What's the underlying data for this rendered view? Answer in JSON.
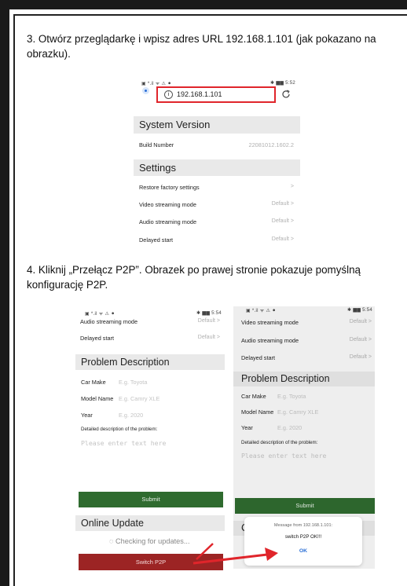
{
  "step3": {
    "text": "3. Otwórz przeglądarkę i wpisz adres URL 192.168.1.101 (jak pokazano na obrazku).",
    "status_left": "▣ *.il ᯤ ⚠ ⚫",
    "status_right": "✱ ▆▆ 5:52",
    "url": "192.168.1.101",
    "system_version": "System Version",
    "build_label": "Build Number",
    "build_value": "22081012.1602.2",
    "settings": "Settings",
    "rows": [
      {
        "label": "Restore factory settings",
        "value": ">"
      },
      {
        "label": "Video streaming mode",
        "value": "Default >"
      },
      {
        "label": "Audio streaming mode",
        "value": "Default >"
      },
      {
        "label": "Delayed start",
        "value": "Default >"
      }
    ]
  },
  "step4": {
    "text": "4. Kliknij „Przełącz P2P”. Obrazek po prawej stronie pokazuje pomyślną konfigurację P2P.",
    "left": {
      "status_left": "▣ *.il ᯤ ⚠ ⚫",
      "status_right": "✱ ▆▆ 5:54",
      "rows": [
        {
          "label": "Audio streaming mode",
          "value": "Default >"
        },
        {
          "label": "Delayed start",
          "value": "Default >"
        }
      ],
      "problem": "Problem Description",
      "fields": [
        {
          "label": "Car Make",
          "ph": "E.g. Toyota"
        },
        {
          "label": "Model Name",
          "ph": "E.g. Camry XLE"
        },
        {
          "label": "Year",
          "ph": "E.g. 2020"
        }
      ],
      "detail": "Detailed description of the problem:",
      "placeholder": "Please enter text here",
      "submit": "Submit",
      "online": "Online Update",
      "checking": "◌ Checking for updates...",
      "switch": "Switch P2P"
    },
    "right": {
      "status_left": "▣ *.il ᯤ ⚠ ⚫",
      "status_right": "✱ ▆▆ 5:54",
      "rows": [
        {
          "label": "Video streaming mode",
          "value": "Default >"
        },
        {
          "label": "Audio streaming mode",
          "value": "Default >"
        },
        {
          "label": "Delayed start",
          "value": "Default >"
        }
      ],
      "problem": "Problem Description",
      "fields": [
        {
          "label": "Car Make",
          "ph": "E.g. Toyota"
        },
        {
          "label": "Model Name",
          "ph": "E.g. Camry XLE"
        },
        {
          "label": "Year",
          "ph": "E.g. 2020"
        }
      ],
      "detail": "Detailed description of the problem:",
      "placeholder": "Please enter text here",
      "submit": "Submit",
      "online_partial": "C",
      "dialog_title": "Message from 192.168.1.101:",
      "dialog_msg": "switch P2P OK!!!",
      "dialog_ok": "OK",
      "copyright": "Copyright©2020 - 2022"
    }
  },
  "colors": {
    "highlight": "#e0252b",
    "submit": "#2f6b2f",
    "switch": "#9c2424",
    "ok": "#2b6fd6"
  }
}
